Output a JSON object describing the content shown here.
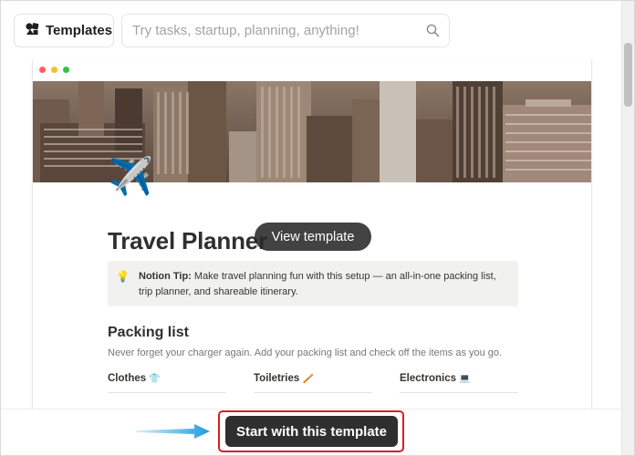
{
  "header": {
    "templates_label": "Templates",
    "search_placeholder": "Try tasks, startup, planning, anything!"
  },
  "preview": {
    "window_dot_colors": [
      "#ff5f57",
      "#febc2e",
      "#28c840"
    ],
    "page_icon": "✈️",
    "title": "Travel Planner",
    "view_template_label": "View template",
    "callout": {
      "icon": "💡",
      "tip_label": "Notion Tip:",
      "text": " Make travel planning fun with this setup — an all-in-one packing list, trip planner, and shareable itinerary."
    },
    "section_heading": "Packing list",
    "section_text": "Never forget your charger again. Add your packing list and check off the items as you go.",
    "columns": [
      {
        "label": "Clothes",
        "icon": "👕"
      },
      {
        "label": "Toiletries",
        "icon": "🪥"
      },
      {
        "label": "Electronics",
        "icon": "💻"
      }
    ]
  },
  "footer": {
    "start_label": "Start with this template"
  },
  "colors": {
    "highlight": "#e01b1b",
    "arrow": "#1e9be0",
    "button_dark": "#2f2f2f"
  }
}
